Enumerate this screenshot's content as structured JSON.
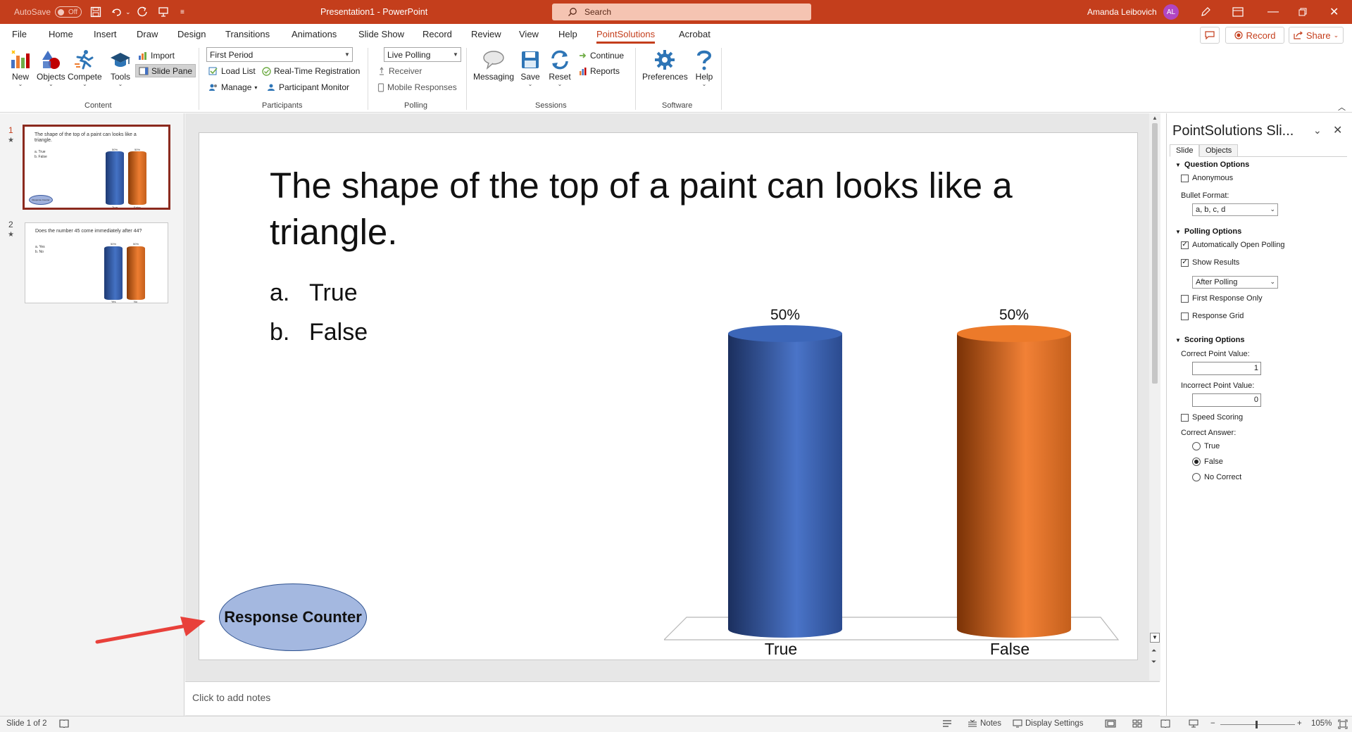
{
  "titlebar": {
    "autosave_label": "AutoSave",
    "autosave_state": "Off",
    "doc_title": "Presentation1  -  PowerPoint",
    "search_placeholder": "Search",
    "user_name": "Amanda Leibovich",
    "user_initials": "AL"
  },
  "menu": {
    "tabs": [
      "File",
      "Home",
      "Insert",
      "Draw",
      "Design",
      "Transitions",
      "Animations",
      "Slide Show",
      "Record",
      "Review",
      "View",
      "Help",
      "PointSolutions",
      "Acrobat"
    ],
    "active_tab": "PointSolutions",
    "record_label": "Record",
    "share_label": "Share"
  },
  "ribbon": {
    "content": {
      "label": "Content",
      "new": "New",
      "objects": "Objects",
      "compete": "Compete",
      "tools": "Tools",
      "import": "Import",
      "slide_pane": "Slide Pane"
    },
    "participants": {
      "label": "Participants",
      "period_value": "First Period",
      "load_list": "Load List",
      "real_time_registration": "Real-Time Registration",
      "manage": "Manage",
      "participant_monitor": "Participant Monitor"
    },
    "polling": {
      "label": "Polling",
      "mode_value": "Live Polling",
      "receiver": "Receiver",
      "mobile_responses": "Mobile Responses"
    },
    "sessions": {
      "label": "Sessions",
      "messaging": "Messaging",
      "save": "Save",
      "reset": "Reset",
      "continue": "Continue",
      "reports": "Reports"
    },
    "software": {
      "label": "Software",
      "preferences": "Preferences",
      "help": "Help"
    }
  },
  "thumbnails": [
    {
      "num": "1",
      "title": "The shape of the top of a paint can looks like a triangle.",
      "answers": [
        "a.  True",
        "b.  False"
      ],
      "pcts": [
        "50%",
        "50%"
      ],
      "cats": [
        "True",
        "False"
      ],
      "oval_text": "Response Counter"
    },
    {
      "num": "2",
      "title": "Does the number 45 come immediately after 44?",
      "answers": [
        "a.  Yes",
        "b.  No"
      ],
      "pcts": [
        "50%",
        "50%"
      ],
      "cats": [
        "Yes",
        "No"
      ]
    }
  ],
  "slide": {
    "title": "The shape of the top of a paint can looks like a triangle.",
    "answers": [
      {
        "marker": "a.",
        "text": "True"
      },
      {
        "marker": "b.",
        "text": "False"
      }
    ],
    "response_counter": "Response Counter"
  },
  "chart_data": {
    "type": "bar",
    "categories": [
      "True",
      "False"
    ],
    "values": [
      50,
      50
    ],
    "data_labels": [
      "50%",
      "50%"
    ],
    "colors": [
      "#3c66b8",
      "#ec7a2a"
    ],
    "ylim": [
      0,
      50
    ],
    "grid": false,
    "legend": "none",
    "title": "",
    "xlabel": "",
    "ylabel": ""
  },
  "notes_placeholder": "Click to add notes",
  "taskpane": {
    "title": "PointSolutions Sli...",
    "tabs": [
      "Slide",
      "Objects"
    ],
    "question_options": {
      "header": "Question Options",
      "anonymous": "Anonymous",
      "anonymous_checked": false,
      "bullet_format_label": "Bullet Format:",
      "bullet_format_value": "a, b, c, d"
    },
    "polling_options": {
      "header": "Polling Options",
      "auto_open": "Automatically Open Polling",
      "auto_open_checked": true,
      "show_results": "Show Results",
      "show_results_checked": true,
      "show_results_value": "After Polling",
      "first_response_only": "First Response Only",
      "response_grid": "Response Grid"
    },
    "scoring_options": {
      "header": "Scoring Options",
      "correct_point_label": "Correct Point Value:",
      "correct_point_value": "1",
      "incorrect_point_label": "Incorrect Point Value:",
      "incorrect_point_value": "0",
      "speed_scoring": "Speed Scoring",
      "correct_answer_label": "Correct Answer:",
      "answers": [
        "True",
        "False",
        "No Correct"
      ],
      "selected": "False"
    }
  },
  "status": {
    "slide_count": "Slide 1 of 2",
    "notes": "Notes",
    "display_settings": "Display Settings",
    "zoom": "105%"
  }
}
